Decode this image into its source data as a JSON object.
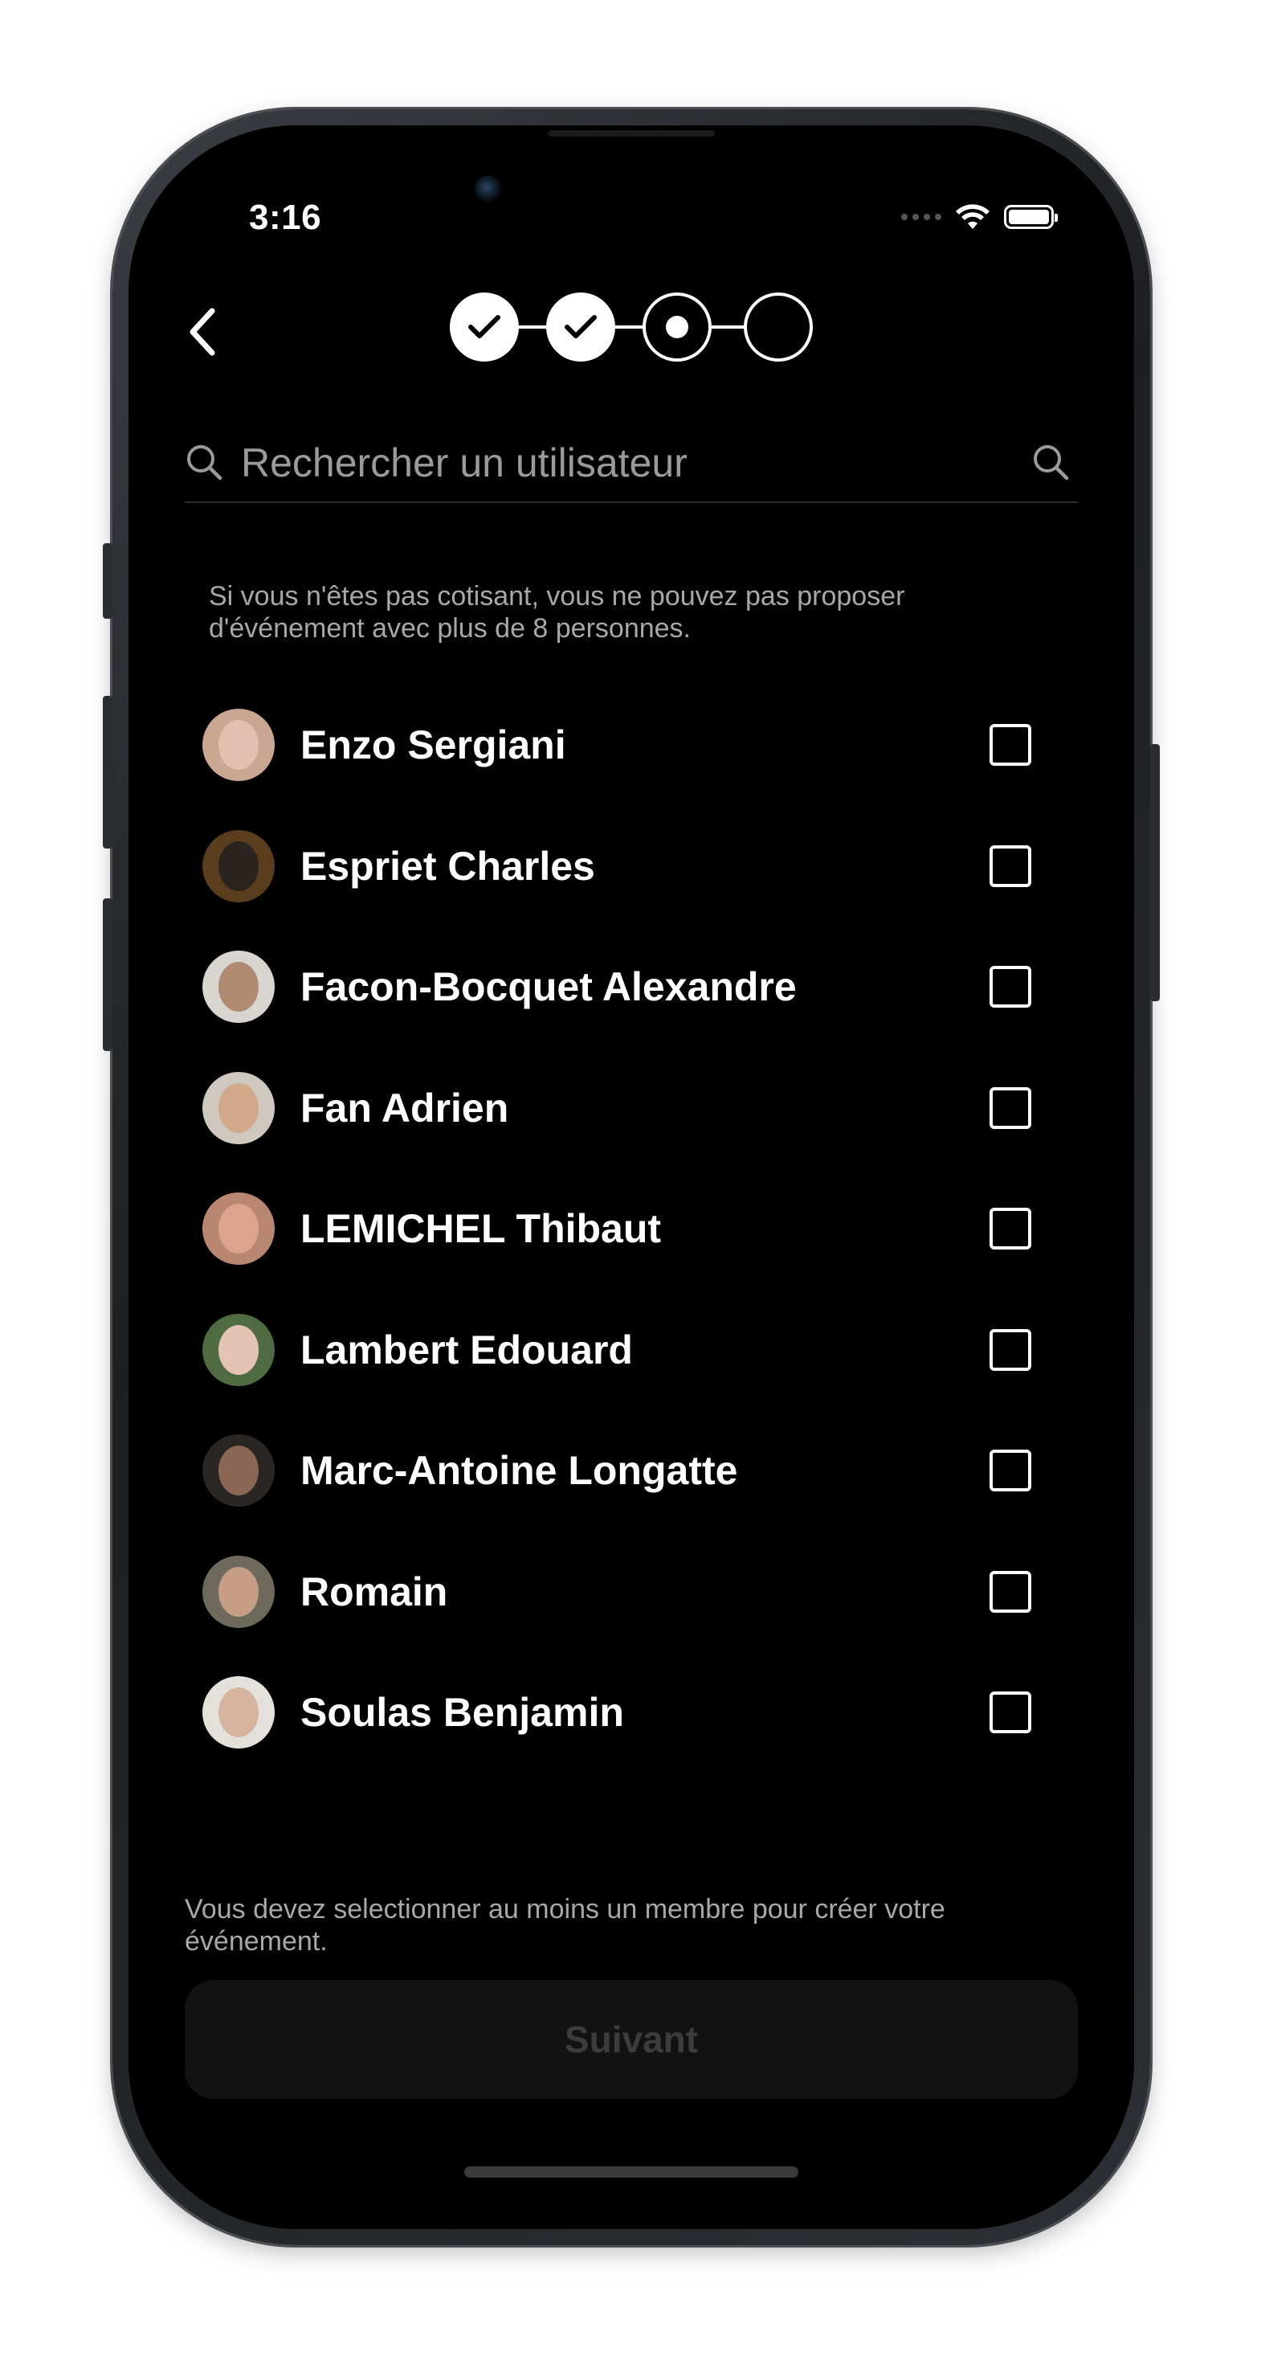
{
  "status_bar": {
    "time": "3:16"
  },
  "stepper": {
    "steps": [
      {
        "state": "done"
      },
      {
        "state": "done"
      },
      {
        "state": "current"
      },
      {
        "state": "pending"
      }
    ]
  },
  "search": {
    "placeholder": "Rechercher un utilisateur"
  },
  "info_note": "Si vous n'êtes pas cotisant, vous ne pouvez pas proposer d'événement avec plus de 8 personnes.",
  "members": [
    {
      "name": "Enzo Sergiani",
      "checked": false,
      "avatar_bg": "#c9a792",
      "avatar_face": "#e2bfae"
    },
    {
      "name": "Espriet Charles",
      "checked": false,
      "avatar_bg": "#5a3d1c",
      "avatar_face": "#2a2420"
    },
    {
      "name": "Facon-Bocquet Alexandre",
      "checked": false,
      "avatar_bg": "#d8d4cf",
      "avatar_face": "#b08b72"
    },
    {
      "name": "Fan Adrien",
      "checked": false,
      "avatar_bg": "#cfc8bf",
      "avatar_face": "#d2a88a"
    },
    {
      "name": "LEMICHEL Thibaut",
      "checked": false,
      "avatar_bg": "#b98672",
      "avatar_face": "#dca48e"
    },
    {
      "name": "Lambert Edouard",
      "checked": false,
      "avatar_bg": "#4f6b42",
      "avatar_face": "#e3c3b3"
    },
    {
      "name": "Marc-Antoine Longatte",
      "checked": false,
      "avatar_bg": "#2a2624",
      "avatar_face": "#8a6755"
    },
    {
      "name": "Romain",
      "checked": false,
      "avatar_bg": "#6d6a5c",
      "avatar_face": "#c69e86"
    },
    {
      "name": "Soulas Benjamin",
      "checked": false,
      "avatar_bg": "#e4e1dc",
      "avatar_face": "#d6b5a0"
    }
  ],
  "bottom_note": "Vous devez selectionner au moins un membre pour créer votre événement.",
  "next_button": {
    "label": "Suivant",
    "enabled": false
  },
  "colors": {
    "background": "#000000",
    "text": "#ffffff",
    "muted_text": "#a8a8a8",
    "button_disabled_bg": "#121212",
    "button_disabled_text": "#3c3c3c"
  },
  "icons": {
    "back": "chevron-left-icon",
    "search_leading": "search-icon",
    "search_trailing": "search-icon",
    "step_done": "checkmark-icon",
    "checkbox": "checkbox-empty-icon"
  }
}
